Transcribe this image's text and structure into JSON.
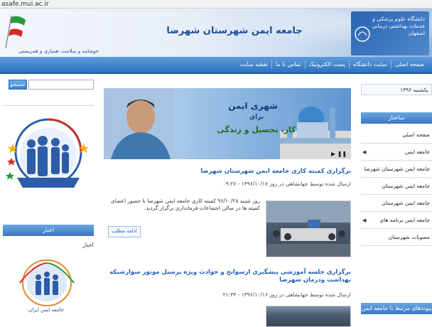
{
  "browser": {
    "url": "asafe.mui.ac.ir"
  },
  "header": {
    "site_title": "جامعه ایمن شهرستان شهرضا",
    "tagline": "خوشایند و سلامت، همیاری و همزیستی",
    "university_name": "دانشگاه علوم پزشکی و خدمات بهداشتی درمانی اصفهان"
  },
  "nav": {
    "items": [
      "صفحه اصلی",
      "سایت دانشگاه",
      "پست الکترونیک",
      "تماس با ما",
      "نقشه سایت"
    ]
  },
  "search": {
    "button_label": "جستجو",
    "placeholder": ""
  },
  "left_sidebar": {
    "logo_caption": "جامعه ایمن شهرضا",
    "news_header": "اخبار",
    "news_label": "اخبار",
    "circle_logo_caption": "جامعه ایمن ایران"
  },
  "slider": {
    "line1": "شهری ایمن",
    "line2": "برای",
    "line3": "کار، تحصیل و زندگی"
  },
  "articles": [
    {
      "title": "برگزاری کمیته کاری جامعه ایمن شهرستان شهرضا",
      "meta": "ارسال شده توسط جهانشاهی در روز ۱۳۹۶/۱۰/۱۷ - ۰۹:۲۷",
      "body": "روز شنبه ۹۶/۱۰/۲۸ کمیته کاری جامعه ایمن شهرضا با حضور اعضای کمیته ها در سالن اجتماعات فرمانداری برگزار گردید.",
      "more_label": "ادامه مطلب"
    },
    {
      "title": "برگزاری جلسه آموزشی پیشگیری ازسوانح و حوادث ویژه پرسنل موتور سوارشبکه بهداشت ودرمان شهرضا",
      "meta": "ارسال شده توسط جهانشاهی در روز ۱۳۹۶/۱۰/۱۶ - ۲۱:۳۳"
    }
  ],
  "right_sidebar": {
    "date": "یکشنبه ۱۳۹۶",
    "menu_header": "ساختار",
    "menu_items": [
      "صفحه اصلی",
      "جامعه ایمن",
      "",
      "جامعه ایمن شهرستان شهرضا",
      "جامعه ایمن شهرستان",
      "",
      "جامعه ایمن شهرستان",
      "",
      "جامعه ایمن برنامه های",
      "مصوبات شهرستان"
    ],
    "links_header": "پیوندهای مرتبط با جامعه ایمن"
  },
  "colors": {
    "nav_blue": "#2f72bf",
    "title_blue": "#1e4f99",
    "link_blue": "#1f5fb0"
  }
}
